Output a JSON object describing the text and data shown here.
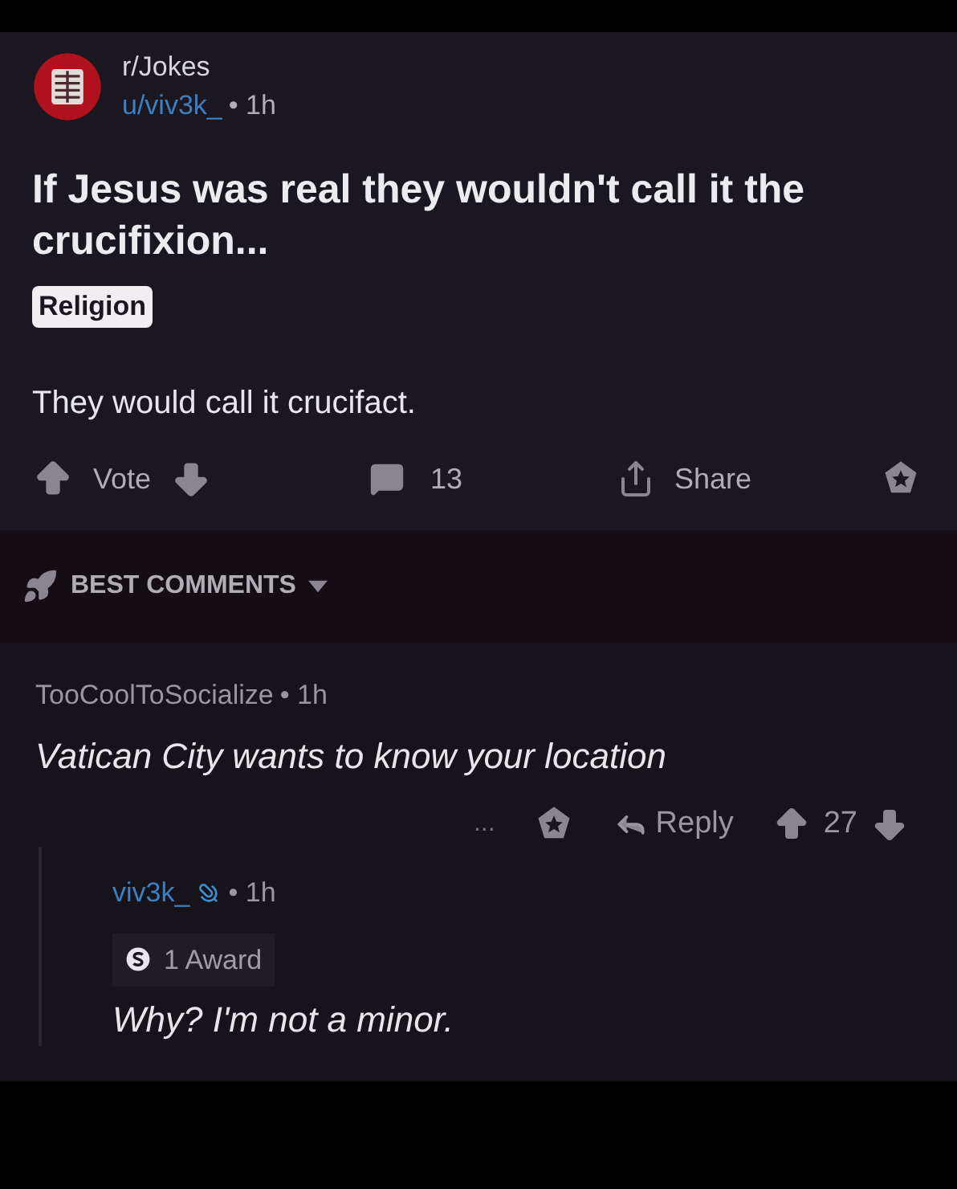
{
  "post": {
    "subreddit": "r/Jokes",
    "author": "u/viv3k_",
    "time": "• 1h",
    "title": "If Jesus was real they wouldn't call it the crucifixion...",
    "flair": "Religion",
    "body": "They would call it crucifact.",
    "vote_label": "Vote",
    "comments": "13",
    "share": "Share"
  },
  "sort": {
    "label": "BEST COMMENTS"
  },
  "comments": [
    {
      "author": "TooCoolToSocialize",
      "op": false,
      "time": "• 1h",
      "text": "Vatican City wants to know your location",
      "reply": "Reply",
      "score": "27",
      "more": "..."
    },
    {
      "author": "viv3k_",
      "op": true,
      "time": "• 1h",
      "award": "1 Award",
      "text": "Why? I'm not a minor."
    }
  ]
}
